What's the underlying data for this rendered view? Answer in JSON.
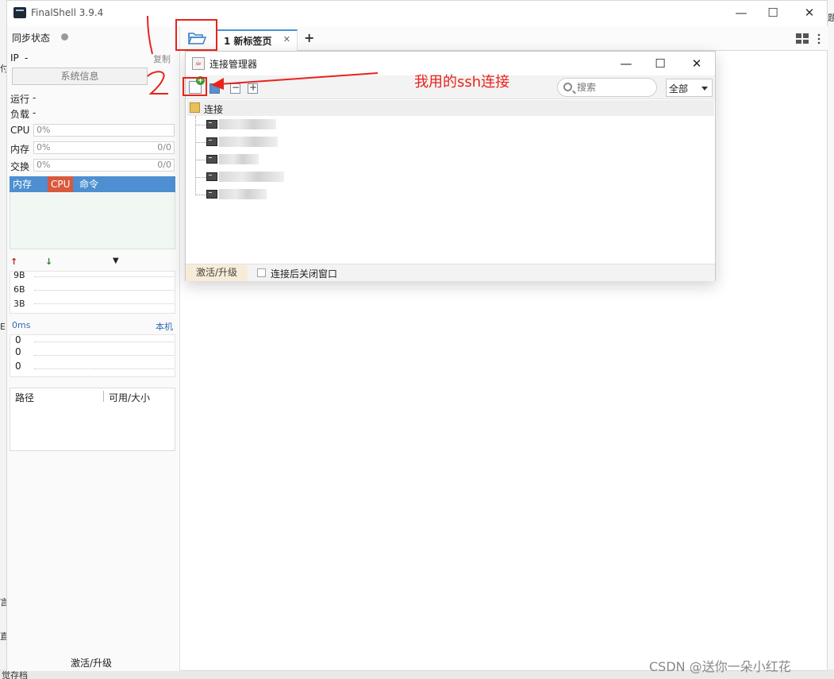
{
  "app": {
    "title": "FinalShell 3.9.4"
  },
  "window_controls": {
    "minimize": "—",
    "maximize": "☐",
    "close": "✕"
  },
  "background": {
    "left_fragments": [
      "付",
      "E",
      "言",
      "直"
    ],
    "bottom_fragment": "觉存档",
    "right_fragment": "题"
  },
  "sidebar": {
    "sync_label": "同步状态",
    "ip_label": "IP",
    "ip_value": "-",
    "copy_label": "复制",
    "sysinfo_button": "系统信息",
    "running_label": "运行",
    "running_value": "-",
    "load_label": "负载",
    "load_value": "-",
    "cpu_label": "CPU",
    "cpu_value": "0%",
    "mem_label": "内存",
    "mem_value": "0%",
    "mem_ratio": "0/0",
    "swap_label": "交换",
    "swap_value": "0%",
    "swap_ratio": "0/0",
    "proc_tabs": [
      "内存",
      "CPU",
      "命令"
    ],
    "net_up_icon": "arrow-up-icon",
    "net_down_icon": "arrow-down-icon",
    "net_scale": [
      "9B",
      "6B",
      "3B"
    ],
    "ping_label": "0ms",
    "ping_host": "本机",
    "ping_scale": [
      "0",
      "0",
      "0"
    ],
    "disk_headers": [
      "路径",
      "可用/大小"
    ],
    "activate_label": "激活/升级"
  },
  "tabbar": {
    "tabs": [
      {
        "label": "1 新标签页",
        "close": "✕"
      }
    ],
    "add_tab": "+"
  },
  "dialog": {
    "title": "连接管理器",
    "controls": {
      "minimize": "—",
      "maximize": "☐",
      "close": "✕"
    },
    "search_placeholder": "搜索",
    "filter_value": "全部",
    "tree_root": "连接",
    "activate_label": "激活/升级",
    "close_after_connect_label": "连接后关闭窗口",
    "close_after_connect_checked": false
  },
  "annotations": {
    "mark_one": "1",
    "mark_two": "2",
    "note": "我用的ssh连接",
    "color": "#e8231b"
  },
  "watermark": "CSDN @送你一朵小红花",
  "colors": {
    "accent": "#4b91d6",
    "proc_header": "#4d8fd0",
    "cpu_tab": "#d9593c"
  }
}
